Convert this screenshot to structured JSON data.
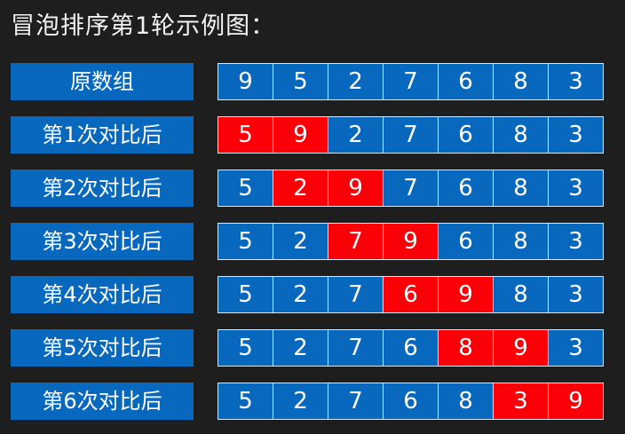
{
  "title": "冒泡排序第1轮示例图：",
  "colors": {
    "background": "#1e1e1e",
    "cell": "#0868be",
    "highlight": "#fb0007",
    "text": "#ffffff"
  },
  "rows": [
    {
      "label": "原数组",
      "values": [
        "9",
        "5",
        "2",
        "7",
        "6",
        "8",
        "3"
      ],
      "highlight": []
    },
    {
      "label": "第1次对比后",
      "values": [
        "5",
        "9",
        "2",
        "7",
        "6",
        "8",
        "3"
      ],
      "highlight": [
        0,
        1
      ]
    },
    {
      "label": "第2次对比后",
      "values": [
        "5",
        "2",
        "9",
        "7",
        "6",
        "8",
        "3"
      ],
      "highlight": [
        1,
        2
      ]
    },
    {
      "label": "第3次对比后",
      "values": [
        "5",
        "2",
        "7",
        "9",
        "6",
        "8",
        "3"
      ],
      "highlight": [
        2,
        3
      ]
    },
    {
      "label": "第4次对比后",
      "values": [
        "5",
        "2",
        "7",
        "6",
        "9",
        "8",
        "3"
      ],
      "highlight": [
        3,
        4
      ]
    },
    {
      "label": "第5次对比后",
      "values": [
        "5",
        "2",
        "7",
        "6",
        "8",
        "9",
        "3"
      ],
      "highlight": [
        4,
        5
      ]
    },
    {
      "label": "第6次对比后",
      "values": [
        "5",
        "2",
        "7",
        "6",
        "8",
        "3",
        "9"
      ],
      "highlight": [
        5,
        6
      ]
    }
  ]
}
